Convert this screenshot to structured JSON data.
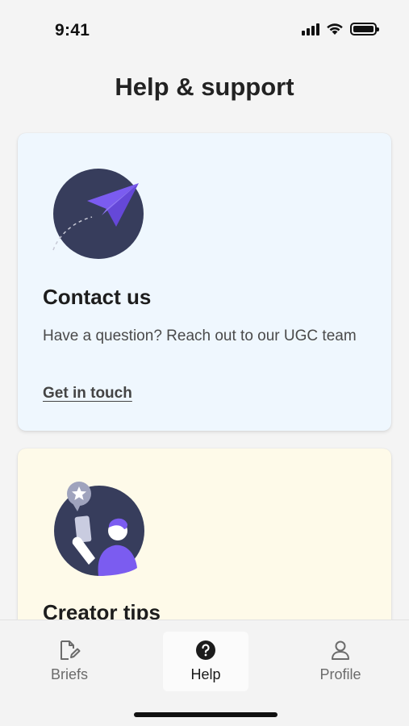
{
  "status": {
    "time": "9:41",
    "icons": [
      "signal-icon",
      "wifi-icon",
      "battery-icon"
    ]
  },
  "header": {
    "title": "Help & support"
  },
  "cards": {
    "contact": {
      "title": "Contact us",
      "description": "Have a question? Reach out to our UGC team",
      "link": "Get in touch",
      "icon": "paper-plane-illustration",
      "background": "#eff7fe"
    },
    "tips": {
      "title": "Creator tips",
      "icon": "creator-star-illustration",
      "background": "#fefae9"
    }
  },
  "nav": {
    "items": [
      {
        "label": "Briefs",
        "icon": "document-edit-icon"
      },
      {
        "label": "Help",
        "icon": "question-circle-icon",
        "active": true
      },
      {
        "label": "Profile",
        "icon": "person-icon"
      }
    ]
  },
  "colors": {
    "accent": "#7b5cf0",
    "illustration_dark": "#373d5c"
  }
}
